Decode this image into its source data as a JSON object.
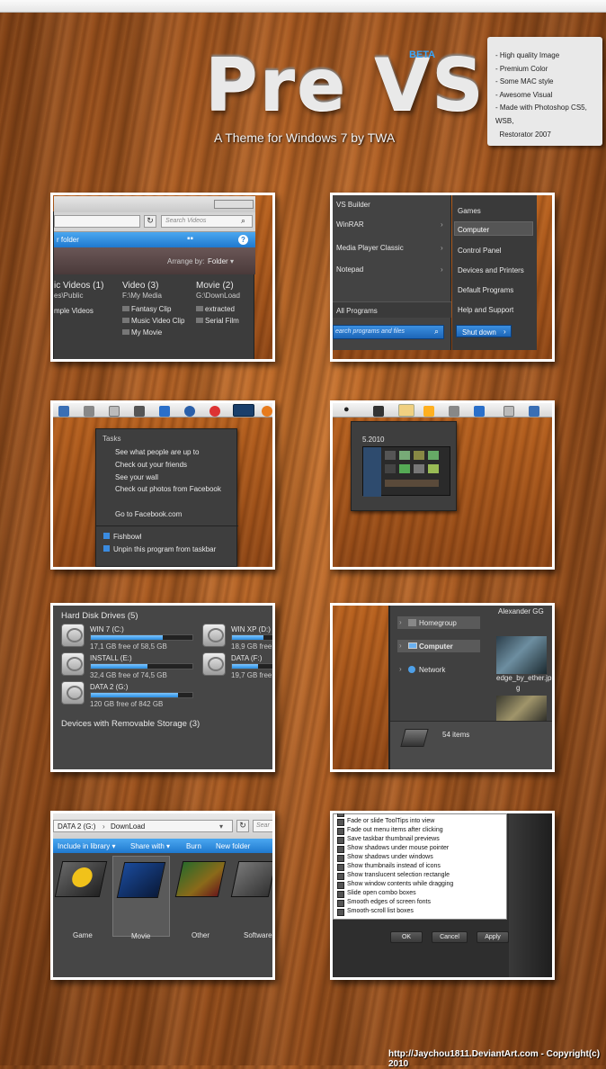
{
  "header": {
    "title": "Pre VS",
    "beta": "BETA",
    "subtitle": "A Theme for Windows 7 by TWA"
  },
  "notes": [
    "- High quality Image",
    "- Premium Color",
    "- Some MAC style",
    "- Awesome Visual",
    "- Made with Photoshop CS5, WSB,",
    "  Restorator 2007"
  ],
  "p1": {
    "search": "Search Videos",
    "breadcrumb": "r folder",
    "arrange_label": "Arrange by:",
    "arrange_value": "Folder",
    "cols": [
      {
        "title": "ic Videos (1)",
        "path": "es\\Public",
        "items": [
          "mple Videos"
        ]
      },
      {
        "title": "Video (3)",
        "path": "F:\\My Media",
        "items": [
          "Fantasy Clip",
          "Music Video Clip",
          "My Movie"
        ]
      },
      {
        "title": "Movie (2)",
        "path": "G:\\DownLoad",
        "items": [
          "extracted",
          "Serial Film"
        ]
      }
    ]
  },
  "p2": {
    "left": [
      "VS Builder",
      "WinRAR",
      "Media Player Classic",
      "Notepad"
    ],
    "all_programs": "All Programs",
    "search": "earch programs and files",
    "right": [
      "Games",
      "Computer",
      "Control Panel",
      "Devices and Printers",
      "Default Programs",
      "Help and Support"
    ],
    "shutdown": "Shut down"
  },
  "p3": {
    "tasks_label": "Tasks",
    "tasks": [
      "See what people are up to",
      "Check out your friends",
      "See your wall",
      "Check out photos from Facebook"
    ],
    "go": "Go to Facebook.com",
    "pin": "Fishbowl",
    "unpin": "Unpin this program from taskbar"
  },
  "p4": {
    "folder": "5.2010"
  },
  "p5": {
    "section": "Hard Disk Drives (5)",
    "drives": [
      {
        "name": "WIN 7 (C:)",
        "free": "17,1 GB free of 58,5 GB",
        "fill": 0.71
      },
      {
        "name": "WIN XP (D:)",
        "free": "18,9 GB free of",
        "fill": 0.6
      },
      {
        "name": "INSTALL (E:)",
        "free": "32,4 GB free of 74,5 GB",
        "fill": 0.56
      },
      {
        "name": "DATA (F:)",
        "free": "19,7 GB free of",
        "fill": 0.5
      },
      {
        "name": "DATA 2 (G:)",
        "free": "120 GB free of 842 GB",
        "fill": 0.86
      }
    ],
    "section2": "Devices with Removable Storage (3)"
  },
  "p6": {
    "user": "Alexander GG",
    "nav": [
      "Homegroup",
      "Computer",
      "Network"
    ],
    "file": "edge_by_ether.jp",
    "file2": "g",
    "count": "54 items"
  },
  "p7": {
    "path": [
      "DATA 2 (G:)",
      "DownLoad"
    ],
    "search": "Sear",
    "toolbar": [
      "Include in library",
      "Share with",
      "Burn",
      "New folder"
    ],
    "folders": [
      "Game",
      "Movie",
      "Other",
      "Software"
    ]
  },
  "p8": {
    "options": [
      "Fade or slide menus into view",
      "Fade or slide ToolTips into view",
      "Fade out menu items after clicking",
      "Save taskbar thumbnail previews",
      "Show shadows under mouse pointer",
      "Show shadows under windows",
      "Show thumbnails instead of icons",
      "Show translucent selection rectangle",
      "Show window contents while dragging",
      "Slide open combo boxes",
      "Smooth edges of screen fonts",
      "Smooth-scroll list boxes"
    ],
    "buttons": [
      "OK",
      "Cancel",
      "Apply"
    ]
  },
  "credit": "http://Jaychou1811.DeviantArt.com - Copyright(c) 2010"
}
